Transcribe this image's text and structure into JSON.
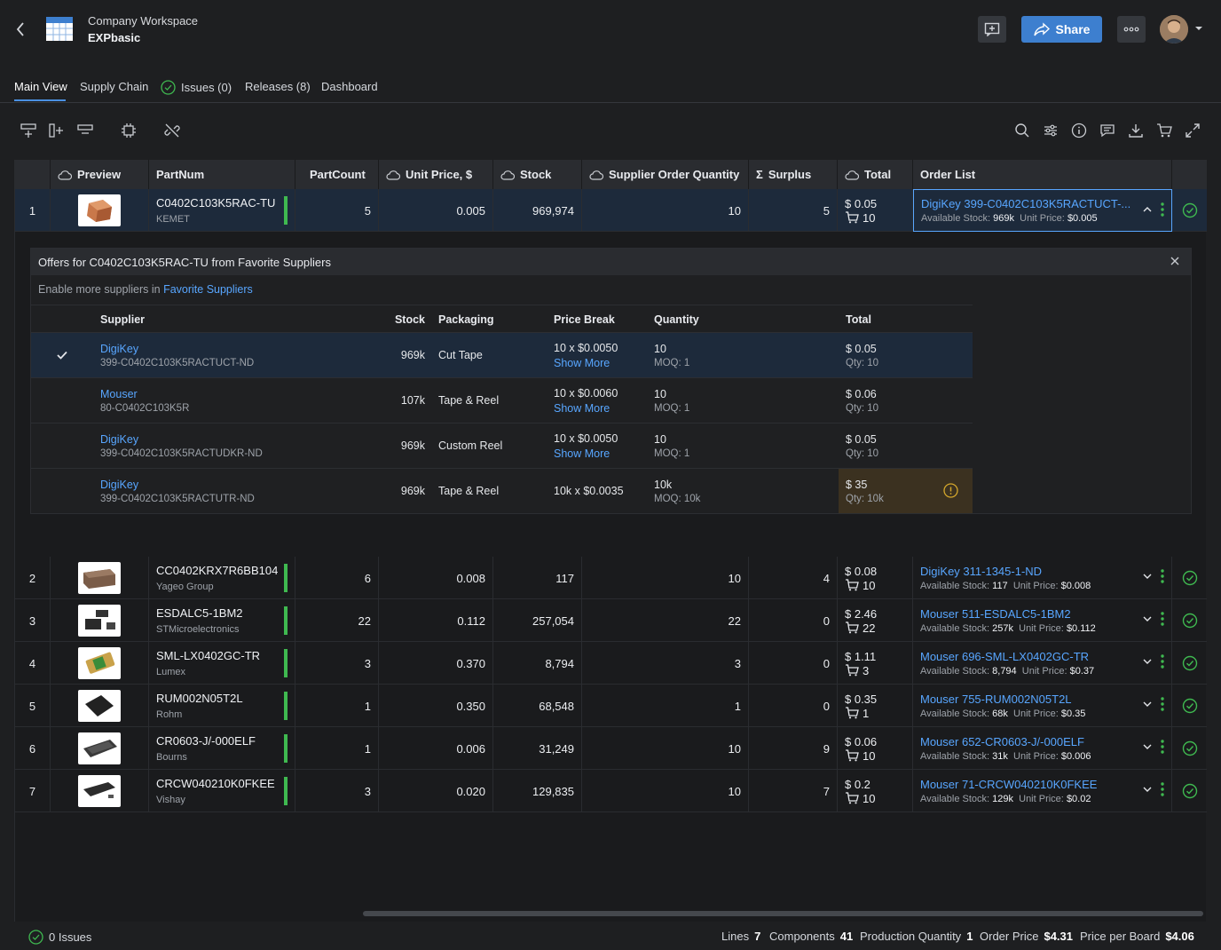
{
  "header": {
    "workspace": "Company Workspace",
    "title": "EXPbasic",
    "share_label": "Share"
  },
  "tabs": [
    {
      "label": "Main View"
    },
    {
      "label": "Supply Chain"
    },
    {
      "label": "Issues (0)"
    },
    {
      "label": "Releases (8)"
    },
    {
      "label": "Dashboard"
    }
  ],
  "columns": {
    "preview": "Preview",
    "partnum": "PartNum",
    "partcount": "PartCount",
    "unit_price": "Unit Price, $",
    "stock": "Stock",
    "soq": "Supplier Order Quantity",
    "surplus": "Surplus",
    "total": "Total",
    "order_list": "Order List"
  },
  "rows": [
    {
      "n": "1",
      "part": "C0402C103K5RAC-TU",
      "mfr": "KEMET",
      "count": "5",
      "price": "0.005",
      "stock": "969,974",
      "soq": "10",
      "surplus": "5",
      "total": "$ 0.05",
      "cart": "10",
      "order": "DigiKey 399-C0402C103K5RACTUCT-...",
      "avail": "969k",
      "unit": "$0.005"
    },
    {
      "n": "2",
      "part": "CC0402KRX7R6BB104",
      "mfr": "Yageo Group",
      "count": "6",
      "price": "0.008",
      "stock": "117",
      "soq": "10",
      "surplus": "4",
      "total": "$ 0.08",
      "cart": "10",
      "order": "DigiKey 311-1345-1-ND",
      "avail": "117",
      "unit": "$0.008"
    },
    {
      "n": "3",
      "part": "ESDALC5-1BM2",
      "mfr": "STMicroelectronics",
      "count": "22",
      "price": "0.112",
      "stock": "257,054",
      "soq": "22",
      "surplus": "0",
      "total": "$ 2.46",
      "cart": "22",
      "order": "Mouser 511-ESDALC5-1BM2",
      "avail": "257k",
      "unit": "$0.112"
    },
    {
      "n": "4",
      "part": "SML-LX0402GC-TR",
      "mfr": "Lumex",
      "count": "3",
      "price": "0.370",
      "stock": "8,794",
      "soq": "3",
      "surplus": "0",
      "total": "$ 1.11",
      "cart": "3",
      "order": "Mouser 696-SML-LX0402GC-TR",
      "avail": "8,794",
      "unit": "$0.37"
    },
    {
      "n": "5",
      "part": "RUM002N05T2L",
      "mfr": "Rohm",
      "count": "1",
      "price": "0.350",
      "stock": "68,548",
      "soq": "1",
      "surplus": "0",
      "total": "$ 0.35",
      "cart": "1",
      "order": "Mouser 755-RUM002N05T2L",
      "avail": "68k",
      "unit": "$0.35"
    },
    {
      "n": "6",
      "part": "CR0603-J/-000ELF",
      "mfr": "Bourns",
      "count": "1",
      "price": "0.006",
      "stock": "31,249",
      "soq": "10",
      "surplus": "9",
      "total": "$ 0.06",
      "cart": "10",
      "order": "Mouser 652-CR0603-J/-000ELF",
      "avail": "31k",
      "unit": "$0.006"
    },
    {
      "n": "7",
      "part": "CRCW040210K0FKEE",
      "mfr": "Vishay",
      "count": "3",
      "price": "0.020",
      "stock": "129,835",
      "soq": "10",
      "surplus": "7",
      "total": "$ 0.2",
      "cart": "10",
      "order": "Mouser 71-CRCW040210K0FKEE",
      "avail": "129k",
      "unit": "$0.02"
    }
  ],
  "order_labels": {
    "available": "Available Stock:",
    "unit": "Unit Price:"
  },
  "offers": {
    "title": "Offers for C0402C103K5RAC-TU from Favorite Suppliers",
    "enable_text": "Enable more suppliers in",
    "enable_link": "Favorite Suppliers",
    "headers": {
      "supplier": "Supplier",
      "stock": "Stock",
      "packaging": "Packaging",
      "price_break": "Price Break",
      "quantity": "Quantity",
      "total": "Total"
    },
    "rows": [
      {
        "supplier": "DigiKey",
        "sku": "399-C0402C103K5RACTUCT-ND",
        "stock": "969k",
        "packaging": "Cut Tape",
        "price_break": "10 x $0.0050",
        "show_more": "Show More",
        "qty": "10",
        "moq": "MOQ: 1",
        "total": "$ 0.05",
        "total_qty": "Qty: 10"
      },
      {
        "supplier": "Mouser",
        "sku": "80-C0402C103K5R",
        "stock": "107k",
        "packaging": "Tape & Reel",
        "price_break": "10 x $0.0060",
        "show_more": "Show More",
        "qty": "10",
        "moq": "MOQ: 1",
        "total": "$ 0.06",
        "total_qty": "Qty: 10"
      },
      {
        "supplier": "DigiKey",
        "sku": "399-C0402C103K5RACTUDKR-ND",
        "stock": "969k",
        "packaging": "Custom Reel",
        "price_break": "10 x $0.0050",
        "show_more": "Show More",
        "qty": "10",
        "moq": "MOQ: 1",
        "total": "$ 0.05",
        "total_qty": "Qty: 10"
      },
      {
        "supplier": "DigiKey",
        "sku": "399-C0402C103K5RACTUTR-ND",
        "stock": "969k",
        "packaging": "Tape & Reel",
        "price_break": "10k x $0.0035",
        "show_more": "",
        "qty": "10k",
        "moq": "MOQ: 10k",
        "total": "$ 35",
        "total_qty": "Qty: 10k"
      }
    ]
  },
  "footer": {
    "issues": "0 Issues",
    "lines_label": "Lines",
    "lines": "7",
    "components_label": "Components",
    "components": "41",
    "pq_label": "Production Quantity",
    "pq": "1",
    "order_price_label": "Order Price",
    "order_price": "$4.31",
    "ppb_label": "Price per Board",
    "ppb": "$4.06"
  },
  "colors": {
    "accent": "#3d7fcf",
    "link": "#58a6ff",
    "ok": "#3fb950",
    "warn": "#d4a72c"
  }
}
